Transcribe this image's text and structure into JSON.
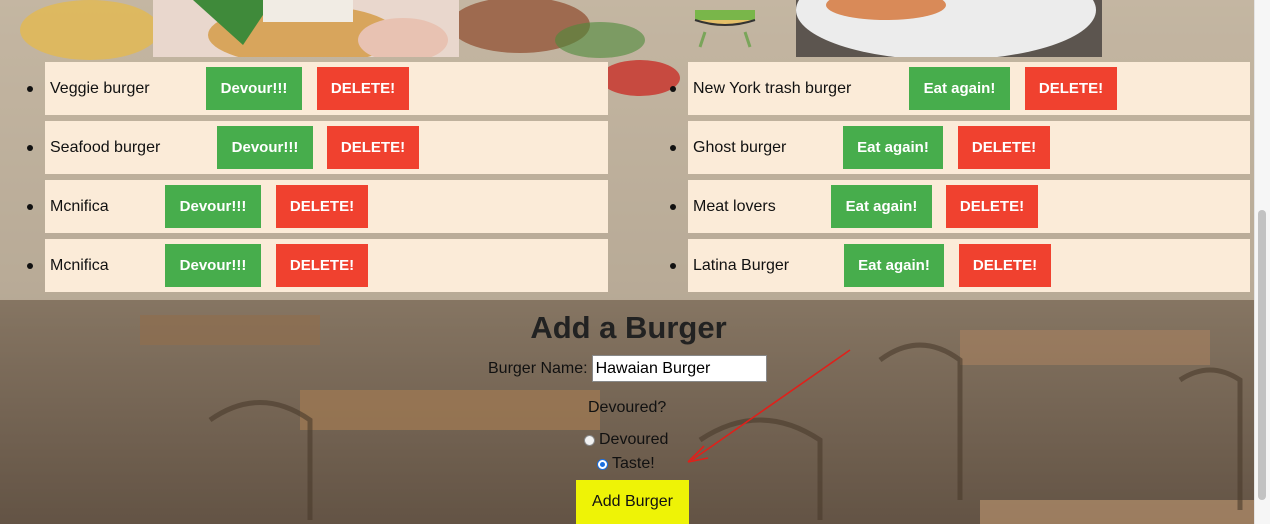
{
  "uneaten": [
    {
      "name": "Veggie burger",
      "action": "Devour!!!",
      "delete": "DELETE!"
    },
    {
      "name": "Seafood burger",
      "action": "Devour!!!",
      "delete": "DELETE!"
    },
    {
      "name": "Mcnifica",
      "action": "Devour!!!",
      "delete": "DELETE!"
    },
    {
      "name": "Mcnifica",
      "action": "Devour!!!",
      "delete": "DELETE!"
    }
  ],
  "eaten": [
    {
      "name": "New York trash burger",
      "action": "Eat again!",
      "delete": "DELETE!"
    },
    {
      "name": "Ghost burger",
      "action": "Eat again!",
      "delete": "DELETE!"
    },
    {
      "name": "Meat lovers",
      "action": "Eat again!",
      "delete": "DELETE!"
    },
    {
      "name": "Latina Burger",
      "action": "Eat again!",
      "delete": "DELETE!"
    }
  ],
  "form": {
    "title": "Add a Burger",
    "name_label": "Burger Name:",
    "name_value": "Hawaian Burger",
    "devoured_question": "Devoured?",
    "option_devoured": "Devoured",
    "option_taste": "Taste!",
    "selected_option": "Taste!",
    "submit_label": "Add Burger"
  },
  "colors": {
    "green": "#47ad4c",
    "red": "#f0412f",
    "list_bg": "#fbebd8",
    "submit_bg": "#eef306",
    "annotation_arrow": "#e0201a"
  }
}
